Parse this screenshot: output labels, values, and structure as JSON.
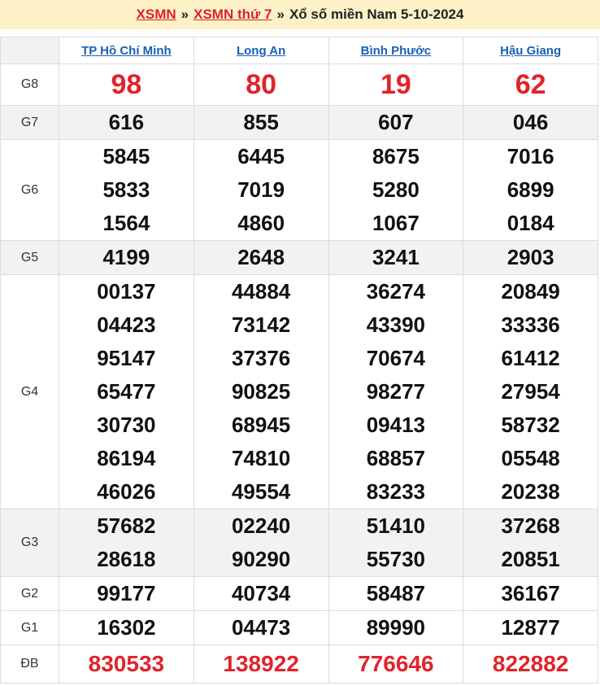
{
  "header": {
    "link1": "XSMN",
    "sep1": "»",
    "link2": "XSMN thứ 7",
    "sep2": "»",
    "title": "Xổ số miền Nam 5-10-2024"
  },
  "provinces": [
    "TP Hồ Chí Minh",
    "Long An",
    "Bình Phước",
    "Hậu Giang"
  ],
  "prizes": [
    {
      "label": "G8",
      "shade": false,
      "style": "big",
      "values": [
        [
          "98"
        ],
        [
          "80"
        ],
        [
          "19"
        ],
        [
          "62"
        ]
      ]
    },
    {
      "label": "G7",
      "shade": true,
      "style": "num",
      "values": [
        [
          "616"
        ],
        [
          "855"
        ],
        [
          "607"
        ],
        [
          "046"
        ]
      ]
    },
    {
      "label": "G6",
      "shade": false,
      "style": "num",
      "values": [
        [
          "5845",
          "5833",
          "1564"
        ],
        [
          "6445",
          "7019",
          "4860"
        ],
        [
          "8675",
          "5280",
          "1067"
        ],
        [
          "7016",
          "6899",
          "0184"
        ]
      ]
    },
    {
      "label": "G5",
      "shade": true,
      "style": "num",
      "values": [
        [
          "4199"
        ],
        [
          "2648"
        ],
        [
          "3241"
        ],
        [
          "2903"
        ]
      ]
    },
    {
      "label": "G4",
      "shade": false,
      "style": "num",
      "values": [
        [
          "00137",
          "04423",
          "95147",
          "65477",
          "30730",
          "86194",
          "46026"
        ],
        [
          "44884",
          "73142",
          "37376",
          "90825",
          "68945",
          "74810",
          "49554"
        ],
        [
          "36274",
          "43390",
          "70674",
          "98277",
          "09413",
          "68857",
          "83233"
        ],
        [
          "20849",
          "33336",
          "61412",
          "27954",
          "58732",
          "05548",
          "20238"
        ]
      ]
    },
    {
      "label": "G3",
      "shade": true,
      "style": "num",
      "values": [
        [
          "57682",
          "28618"
        ],
        [
          "02240",
          "90290"
        ],
        [
          "51410",
          "55730"
        ],
        [
          "37268",
          "20851"
        ]
      ]
    },
    {
      "label": "G2",
      "shade": false,
      "style": "num",
      "values": [
        [
          "99177"
        ],
        [
          "40734"
        ],
        [
          "58487"
        ],
        [
          "36167"
        ]
      ]
    },
    {
      "label": "G1",
      "shade": false,
      "style": "num",
      "values": [
        [
          "16302"
        ],
        [
          "04473"
        ],
        [
          "89990"
        ],
        [
          "12877"
        ]
      ]
    },
    {
      "label": "ĐB",
      "shade": false,
      "style": "db",
      "values": [
        [
          "830533"
        ],
        [
          "138922"
        ],
        [
          "776646"
        ],
        [
          "822882"
        ]
      ]
    }
  ],
  "colors": {
    "accent_red": "#e0242b",
    "link_blue": "#1a5fb4",
    "header_bg": "#fdf1c7"
  }
}
